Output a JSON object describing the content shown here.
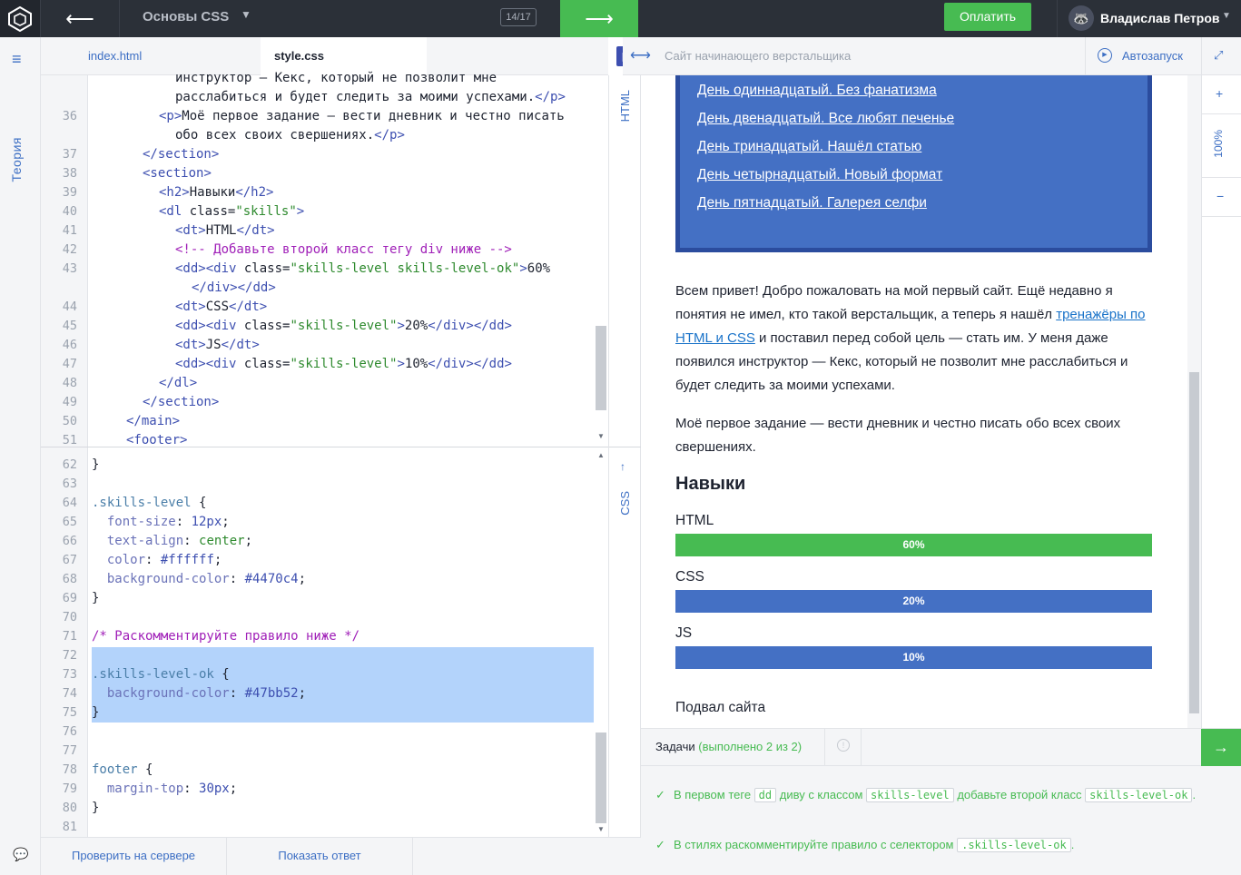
{
  "header": {
    "course_title": "Основы CSS",
    "progress_counter": "14/17",
    "pay_label": "Оплатить",
    "user_name": "Владислав Петров"
  },
  "sidebar": {
    "theory_label": "Теория"
  },
  "editor_tabs": [
    {
      "label": "index.html"
    },
    {
      "label": "style.css"
    }
  ],
  "html_code": {
    "lines": [
      {
        "num": "",
        "text": "инструктор — Кекс, который не позволит мне"
      },
      {
        "num": "",
        "text": "расслабиться и будет следить за моими успехами.</p>"
      },
      {
        "num": "36",
        "text": "<p>Моё первое задание — вести дневник и честно писать"
      },
      {
        "num": "",
        "text": "обо всех своих свершениях.</p>"
      },
      {
        "num": "37",
        "text": "</section>"
      },
      {
        "num": "38",
        "text": "<section>"
      },
      {
        "num": "39",
        "text": "<h2>Навыки</h2>"
      },
      {
        "num": "40",
        "text": "<dl class=\"skills\">"
      },
      {
        "num": "41",
        "text": "<dt>HTML</dt>"
      },
      {
        "num": "42",
        "text": "<!-- Добавьте второй класс тегу div ниже -->"
      },
      {
        "num": "43",
        "text": "<dd><div class=\"skills-level skills-level-ok\">60%"
      },
      {
        "num": "",
        "text": "</div></dd>"
      },
      {
        "num": "44",
        "text": "<dt>CSS</dt>"
      },
      {
        "num": "45",
        "text": "<dd><div class=\"skills-level\">20%</div></dd>"
      },
      {
        "num": "46",
        "text": "<dt>JS</dt>"
      },
      {
        "num": "47",
        "text": "<dd><div class=\"skills-level\">10%</div></dd>"
      },
      {
        "num": "48",
        "text": "</dl>"
      },
      {
        "num": "49",
        "text": "</section>"
      },
      {
        "num": "50",
        "text": "</main>"
      },
      {
        "num": "51",
        "text": "<footer>"
      }
    ]
  },
  "css_code": {
    "lines": [
      {
        "num": "62",
        "text": "}"
      },
      {
        "num": "63",
        "text": ""
      },
      {
        "num": "64",
        "text": ".skills-level {"
      },
      {
        "num": "65",
        "text": "  font-size: 12px;"
      },
      {
        "num": "66",
        "text": "  text-align: center;"
      },
      {
        "num": "67",
        "text": "  color: #ffffff;"
      },
      {
        "num": "68",
        "text": "  background-color: #4470c4;"
      },
      {
        "num": "69",
        "text": "}"
      },
      {
        "num": "70",
        "text": ""
      },
      {
        "num": "71",
        "text": "/* Раскомментируйте правило ниже */"
      },
      {
        "num": "72",
        "text": ""
      },
      {
        "num": "73",
        "text": ".skills-level-ok {"
      },
      {
        "num": "74",
        "text": "  background-color: #47bb52;"
      },
      {
        "num": "75",
        "text": "}"
      },
      {
        "num": "76",
        "text": ""
      },
      {
        "num": "77",
        "text": ""
      },
      {
        "num": "78",
        "text": "footer {"
      },
      {
        "num": "79",
        "text": "  margin-top: 30px;"
      },
      {
        "num": "80",
        "text": "}"
      },
      {
        "num": "81",
        "text": ""
      }
    ]
  },
  "side_labels": {
    "html": "HTML",
    "css": "CSS"
  },
  "bottom_actions": {
    "check": "Проверить на сервере",
    "show_answer": "Показать ответ"
  },
  "preview_header": {
    "title": "Сайт начинающего верстальщика",
    "autorun": "Автозапуск"
  },
  "zoom": {
    "value": "100%"
  },
  "preview": {
    "nav_links": [
      "День одиннадцатый. Без фанатизма",
      "День двенадцатый. Все любят печенье",
      "День тринадцатый. Нашёл статью",
      "День четырнадцатый. Новый формат",
      "День пятнадцатый. Галерея селфи"
    ],
    "intro_before_link": "Всем привет! Добро пожаловать на мой первый сайт. Ещё недавно я понятия не имел, кто такой верстальщик, а теперь я нашёл ",
    "intro_link": "тренажёры по HTML и CSS",
    "intro_after_link": " и поставил перед собой цель — стать им. У меня даже появился инструктор — Кекс, который не позволит мне расслабиться и будет следить за моими успехами.",
    "para2": "Моё первое задание — вести дневник и честно писать обо всех своих свершениях.",
    "skills_heading": "Навыки",
    "skills": [
      {
        "name": "HTML",
        "level": "60%",
        "color": "#47bb52"
      },
      {
        "name": "CSS",
        "level": "20%",
        "color": "#4470c4"
      },
      {
        "name": "JS",
        "level": "10%",
        "color": "#4470c4"
      }
    ],
    "footer_text": "Подвал сайта"
  },
  "tasks": {
    "title": "Задачи",
    "count": "(выполнено 2 из 2)",
    "items": [
      {
        "parts": [
          "В первом теге ",
          "dd",
          " диву с классом ",
          "skills-level",
          " добавьте второй класс ",
          "skills-level-ok",
          "."
        ]
      },
      {
        "parts": [
          "В стилях раскомментируйте правило с селектором ",
          ".skills-level-ok",
          "."
        ]
      }
    ]
  },
  "colors": {
    "accent": "#47bb52",
    "link": "#3d6fc4",
    "skill_blue": "#4470c4"
  }
}
